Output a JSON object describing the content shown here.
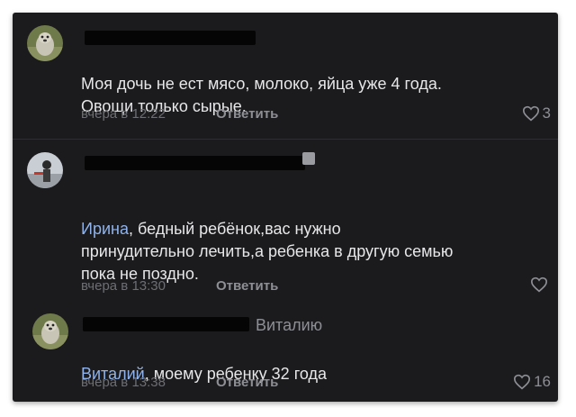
{
  "comments": [
    {
      "text": "Моя дочь не ест мясо, молоко, яйца уже 4 года.\nОвощи только сырые.",
      "time": "вчера в 12:22",
      "reply_label": "Ответить",
      "likes": "3"
    },
    {
      "mention": "Ирина",
      "text": ", бедный ребёнок,вас нужно\nпринудительно лечить,а ребенка в другую семью\nпока не поздно.",
      "time": "вчера в 13:30",
      "reply_label": "Ответить",
      "likes": ""
    },
    {
      "reply_to": "Виталию",
      "mention": "Виталий",
      "text": ", моему ребенку 32 года",
      "time": "вчера в 13:38",
      "reply_label": "Ответить",
      "likes": "16"
    }
  ],
  "colors": {
    "background": "#1b1b1d",
    "text": "#e7e7ea",
    "mention": "#8fb3ea",
    "muted": "#6d6e73"
  },
  "icons": [
    "avatar-dog",
    "avatar-person",
    "heart-icon"
  ]
}
